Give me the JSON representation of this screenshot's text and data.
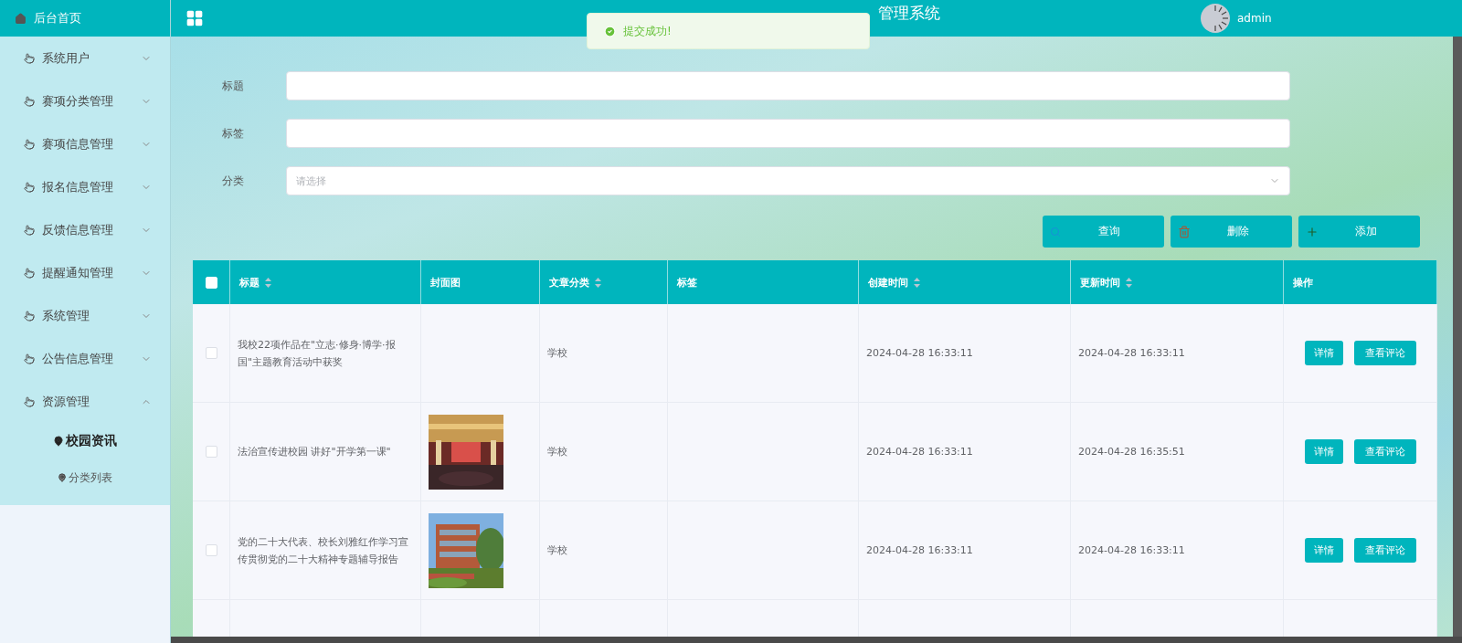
{
  "header": {
    "title": "管理系统",
    "user": "admin"
  },
  "toast": {
    "text": "提交成功!"
  },
  "sidebar": {
    "home": "后台首页",
    "items": [
      {
        "label": "系统用户",
        "expanded": false
      },
      {
        "label": "赛项分类管理",
        "expanded": false
      },
      {
        "label": "赛项信息管理",
        "expanded": false
      },
      {
        "label": "报名信息管理",
        "expanded": false
      },
      {
        "label": "反馈信息管理",
        "expanded": false
      },
      {
        "label": "提醒通知管理",
        "expanded": false
      },
      {
        "label": "系统管理",
        "expanded": false
      },
      {
        "label": "公告信息管理",
        "expanded": false
      },
      {
        "label": "资源管理",
        "expanded": true,
        "children": [
          {
            "label": "校园资讯",
            "selected": true
          },
          {
            "label": "分类列表",
            "selected": false
          }
        ]
      }
    ]
  },
  "filters": [
    {
      "kind": "text",
      "label": "标题"
    },
    {
      "kind": "text",
      "label": "标签"
    },
    {
      "kind": "select",
      "label": "分类",
      "placeholder": "请选择"
    }
  ],
  "buttons": [
    {
      "kind": "search",
      "label": "查询"
    },
    {
      "kind": "delete",
      "label": "删除"
    },
    {
      "kind": "add",
      "label": "添加"
    }
  ],
  "table": {
    "all_checked": false,
    "columns": [
      {
        "label": "标题",
        "sortable": true
      },
      {
        "label": "封面图",
        "sortable": false
      },
      {
        "label": "文章分类",
        "sortable": true
      },
      {
        "label": "标签",
        "sortable": false
      },
      {
        "label": "创建时间",
        "sortable": true
      },
      {
        "label": "更新时间",
        "sortable": true
      },
      {
        "label": "操作",
        "sortable": false
      }
    ],
    "rows": [
      {
        "checked": false,
        "title": "我校22项作品在\"立志·修身·博学·报国\"主题教育活动中获奖",
        "category": "学校",
        "created": "2024-04-28 16:33:11",
        "updated": "2024-04-28 16:33:11",
        "actions": [
          "详情",
          "查看评论"
        ]
      },
      {
        "checked": false,
        "title": "法治宣传进校园 讲好\"开学第一课\"",
        "cover": {
          "kind": "picture"
        },
        "category": "学校",
        "created": "2024-04-28 16:33:11",
        "updated": "2024-04-28 16:35:51",
        "actions": [
          "详情",
          "查看评论"
        ]
      },
      {
        "checked": false,
        "title": "党的二十大代表、校长刘雅红作学习宣传贯彻党的二十大精神专题辅导报告",
        "cover": {
          "kind": "picture"
        },
        "category": "学校",
        "created": "2024-04-28 16:33:11",
        "updated": "2024-04-28 16:33:11",
        "actions": [
          "详情",
          "查看评论"
        ]
      }
    ]
  }
}
